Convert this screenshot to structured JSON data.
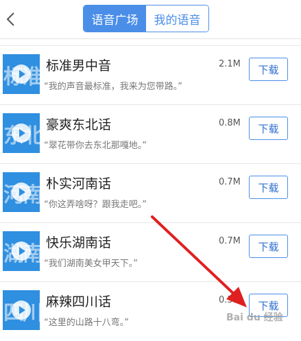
{
  "header": {
    "tabs": [
      {
        "label": "语音广场",
        "active": true
      },
      {
        "label": "我的语音",
        "active": false
      }
    ]
  },
  "voices": [
    {
      "name": "标准男中音",
      "thumb": "标准",
      "quote": "“我的声音最标准，我来为您带路。”",
      "size": "2.1M",
      "download_label": "下载"
    },
    {
      "name": "豪爽东北话",
      "thumb": "东北",
      "quote": "“翠花带你去东北那嘎地。”",
      "size": "0.8M",
      "download_label": "下载"
    },
    {
      "name": "朴实河南话",
      "thumb": "河南",
      "quote": "“你这弄啥呀？跟我走吧。”",
      "size": "0.7M",
      "download_label": "下载"
    },
    {
      "name": "快乐湖南话",
      "thumb": "湖南",
      "quote": "“我们湖南美女甲天下。”",
      "size": "0.7M",
      "download_label": "下载"
    },
    {
      "name": "麻辣四川话",
      "thumb": "四川",
      "quote": "“这里的山路十八弯。”",
      "size": "0.5M",
      "download_label": "下载"
    }
  ],
  "colors": {
    "accent": "#4a8ee8",
    "thumb": "#2f8fe0",
    "arrow": "#e02020"
  }
}
